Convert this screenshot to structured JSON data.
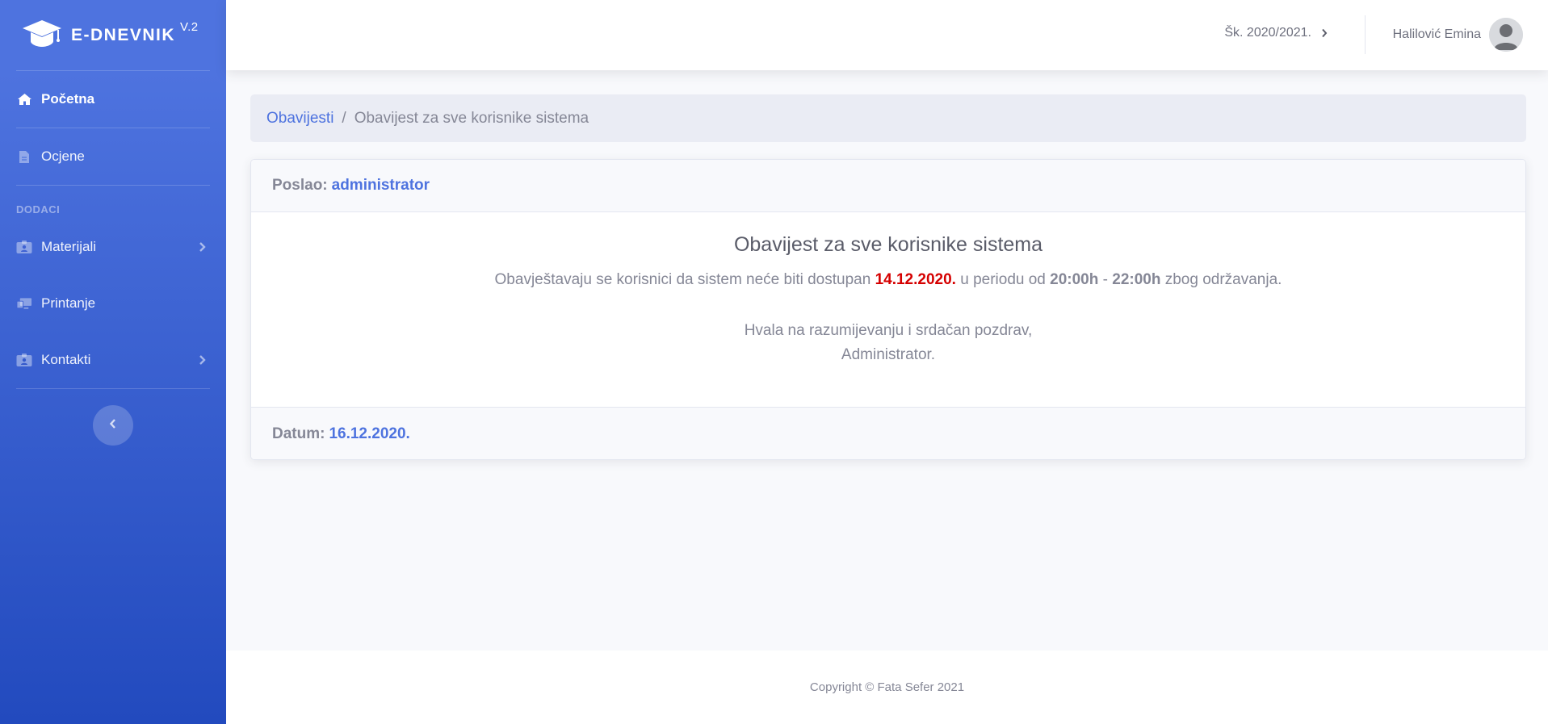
{
  "brand": {
    "name": "E-DNEVNIK",
    "version": "V.2"
  },
  "sidebar": {
    "items": [
      {
        "label": "Početna",
        "icon": "home-icon"
      },
      {
        "label": "Ocjene",
        "icon": "file-icon"
      },
      {
        "label": "Materijali",
        "icon": "id-badge-icon"
      },
      {
        "label": "Printanje",
        "icon": "desktop-icon"
      },
      {
        "label": "Kontakti",
        "icon": "id-badge-icon"
      }
    ],
    "heading": "DODACI"
  },
  "topbar": {
    "school_year": "Šk. 2020/2021.",
    "user_name": "Halilović Emina"
  },
  "breadcrumb": {
    "parent": "Obavijesti",
    "separator": "/",
    "current": "Obavijest za sve korisnike sistema"
  },
  "notice": {
    "sender_label": "Poslao:",
    "sender": "administrator",
    "title": "Obavijest za sve korisnike sistema",
    "text_1": "Obavještavaju se korisnici da sistem neće biti dostupan",
    "date": "14.12.2020.",
    "text_2": "u periodu od",
    "time_from": "20:00h",
    "dash": "-",
    "time_to": "22:00h",
    "text_3": "zbog održavanja.",
    "closing_1": "Hvala na razumijevanju i srdačan pozdrav,",
    "closing_2": "Administrator.",
    "date_label": "Datum:",
    "published": "16.12.2020."
  },
  "footer": {
    "copyright": "Copyright © Fata Sefer 2021"
  },
  "colors": {
    "primary": "#4e73df",
    "sidebar_end": "#224abe",
    "alert": "#d50000"
  }
}
